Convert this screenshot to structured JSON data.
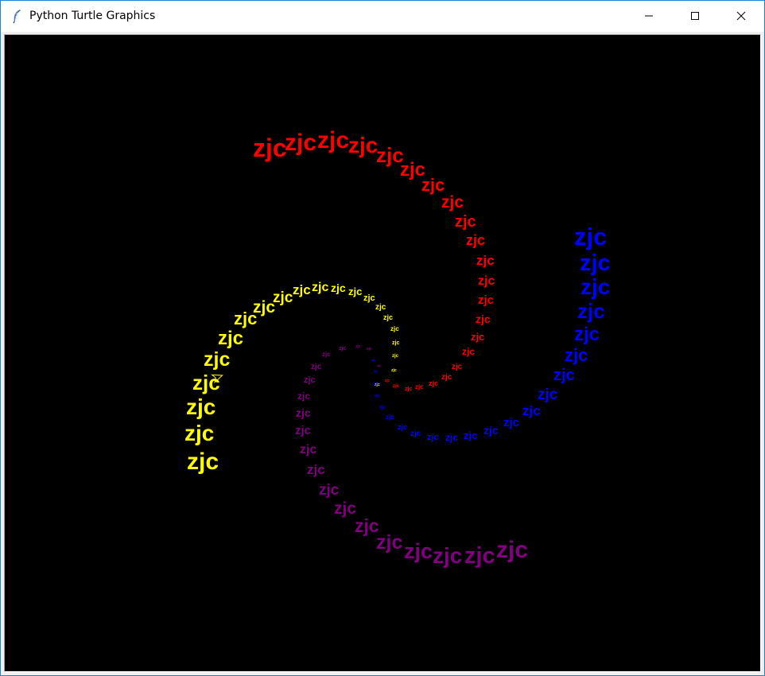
{
  "window": {
    "title": "Python Turtle Graphics"
  },
  "icons": {
    "app": "feather-icon",
    "minimize": "minimize-icon",
    "maximize": "maximize-icon",
    "close": "close-icon"
  },
  "canvas": {
    "background": "#000000",
    "stamp_text": "zjc",
    "colors": {
      "red_arm": "#ff0000",
      "yellow_arm": "#ffff00",
      "purple_arm": "#800080",
      "blue_arm": "#0000ff"
    },
    "turtle_cursor": "turtle-arrow-icon"
  }
}
